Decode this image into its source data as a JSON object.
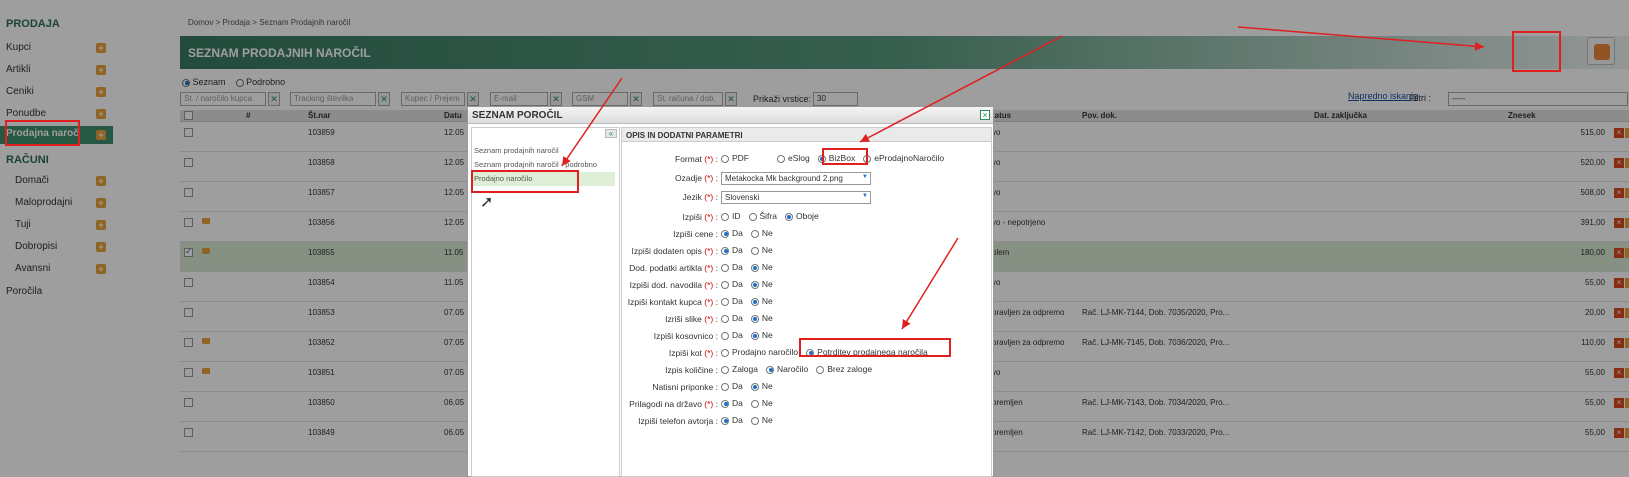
{
  "sidebar": {
    "sections": [
      {
        "header": "PRODAJA",
        "items": [
          {
            "label": "Kupci"
          },
          {
            "label": "Artikli"
          },
          {
            "label": "Ceniki"
          },
          {
            "label": "Ponudbe"
          },
          {
            "label": "Prodajna naročila"
          }
        ]
      },
      {
        "header": "RAČUNI",
        "items": [
          {
            "label": "Domači"
          },
          {
            "label": "Maloprodajni"
          },
          {
            "label": "Tuji"
          },
          {
            "label": "Dobropisi"
          },
          {
            "label": "Avansni"
          }
        ]
      }
    ],
    "reports": "Poročila"
  },
  "breadcrumb": {
    "home": "Domov",
    "sep": ">",
    "section": "Prodaja",
    "page": "Seznam Prodajnih naročil"
  },
  "page": {
    "title": "SEZNAM PRODAJNIH NAROČIL"
  },
  "view": {
    "list": "Seznam",
    "detail": "Podrobno"
  },
  "filters": {
    "placeholders": [
      "St. / naročilo kupca",
      "Tracking številka",
      "Kupec / Prejem",
      "E-mail",
      "GSM",
      "St. računa / dob."
    ],
    "rows_label": "Prikaži vrstice:",
    "rows_value": "30",
    "advanced": "Napredno iskanje",
    "filter_label": "Filtri :",
    "filter_value": "-----"
  },
  "table": {
    "columns": {
      "num": "#",
      "stnar": "Št.nar",
      "datum": "Datu",
      "status": "tatus",
      "povdok": "Pov. dok.",
      "datzak": "Dat. zaključka",
      "znesek": "Znesek"
    },
    "rows": [
      {
        "stnar": "103859",
        "datum": "12.05",
        "status": "vo",
        "povdok": "",
        "znesek": "515,00",
        "mail": false,
        "checked": false
      },
      {
        "stnar": "103858",
        "datum": "12.05",
        "status": "vo",
        "povdok": "",
        "znesek": "520,00",
        "mail": false,
        "checked": false
      },
      {
        "stnar": "103857",
        "datum": "12.05",
        "status": "vo",
        "povdok": "",
        "znesek": "508,00",
        "mail": false,
        "checked": false
      },
      {
        "stnar": "103856",
        "datum": "12.05",
        "status": "vo - nepotrjeno",
        "povdok": "",
        "znesek": "391,00",
        "mail": true,
        "checked": false
      },
      {
        "stnar": "103855",
        "datum": "11.05",
        "status": "blem",
        "povdok": "",
        "znesek": "180,00",
        "mail": true,
        "checked": true
      },
      {
        "stnar": "103854",
        "datum": "11.05",
        "status": "vo",
        "povdok": "",
        "znesek": "55,00",
        "mail": false,
        "checked": false
      },
      {
        "stnar": "103853",
        "datum": "07.05",
        "status": "pravljen za odpremo",
        "povdok": "Rač. LJ-MK-7144, Dob. 7035/2020, Pro...",
        "znesek": "20,00",
        "mail": false,
        "checked": false
      },
      {
        "stnar": "103852",
        "datum": "07.05",
        "status": "pravljen za odpremo",
        "povdok": "Rač. LJ-MK-7145, Dob. 7036/2020, Pro...",
        "znesek": "110,00",
        "mail": true,
        "checked": false
      },
      {
        "stnar": "103851",
        "datum": "07.05",
        "status": "vo",
        "povdok": "",
        "znesek": "55,00",
        "mail": true,
        "checked": false
      },
      {
        "stnar": "103850",
        "datum": "06.05",
        "status": "premljen",
        "povdok": "Rač. LJ-MK-7143, Dob. 7034/2020, Pro...",
        "znesek": "55,00",
        "mail": false,
        "checked": false
      },
      {
        "stnar": "103849",
        "datum": "06.05",
        "status": "premljen",
        "povdok": "Rač. LJ-MK-7142, Dob. 7033/2020, Pro...",
        "znesek": "55,00",
        "mail": false,
        "checked": false
      }
    ]
  },
  "dialog": {
    "title": "SEZNAM POROČIL",
    "reports": [
      "Seznam prodajnih naročil",
      "Seznam prodajnih naročil - podrobno",
      "Prodajno naročilo"
    ],
    "options_title": "OPIS IN DODATNI PARAMETRI",
    "fields": [
      {
        "label": "Format",
        "req": true,
        "opts": [
          "PDF",
          "eSlog",
          "BizBox",
          "eProdajnoNaročilo"
        ],
        "sel": 2
      },
      {
        "label": "Ozadje",
        "req": true,
        "select": "Metakocka Mk background 2.png"
      },
      {
        "label": "Jezik",
        "req": true,
        "select": "Slovenski"
      },
      {
        "label": "Izpiši",
        "req": true,
        "opts": [
          "ID",
          "Šifra",
          "Oboje"
        ],
        "sel": 2
      },
      {
        "label": "Izpiši cene",
        "req": false,
        "opts": [
          "Da",
          "Ne"
        ],
        "sel": 0
      },
      {
        "label": "Izpiši dodaten opis",
        "req": true,
        "opts": [
          "Da",
          "Ne"
        ],
        "sel": 0
      },
      {
        "label": "Dod. podatki artikla",
        "req": true,
        "opts": [
          "Da",
          "Ne"
        ],
        "sel": 1
      },
      {
        "label": "Izpiši dod. navodila",
        "req": true,
        "opts": [
          "Da",
          "Ne"
        ],
        "sel": 1
      },
      {
        "label": "Izpiši kontakt kupca",
        "req": true,
        "opts": [
          "Da",
          "Ne"
        ],
        "sel": 1
      },
      {
        "label": "Izriši slike",
        "req": true,
        "opts": [
          "Da",
          "Ne"
        ],
        "sel": 1
      },
      {
        "label": "Izpiši kosovnico",
        "req": false,
        "opts": [
          "Da",
          "Ne"
        ],
        "sel": 1
      },
      {
        "label": "Izpiši kot",
        "req": true,
        "opts": [
          "Prodajno naročilo",
          "Potrditev prodajnega naročila"
        ],
        "sel": 1
      },
      {
        "label": "Izpis količine",
        "req": false,
        "opts": [
          "Zaloga",
          "Naročilo",
          "Brez zaloge"
        ],
        "sel": 1
      },
      {
        "label": "Natisni priponke",
        "req": false,
        "opts": [
          "Da",
          "Ne"
        ],
        "sel": 1
      },
      {
        "label": "Prilagodi na državo",
        "req": true,
        "opts": [
          "Da",
          "Ne"
        ],
        "sel": 0
      },
      {
        "label": "Izpiši telefon avtorja",
        "req": false,
        "opts": [
          "Da",
          "Ne"
        ],
        "sel": 0
      }
    ]
  },
  "colors": {
    "accent": "#3e8f6f",
    "annotation": "#e02020",
    "plus": "#e8a23a"
  }
}
